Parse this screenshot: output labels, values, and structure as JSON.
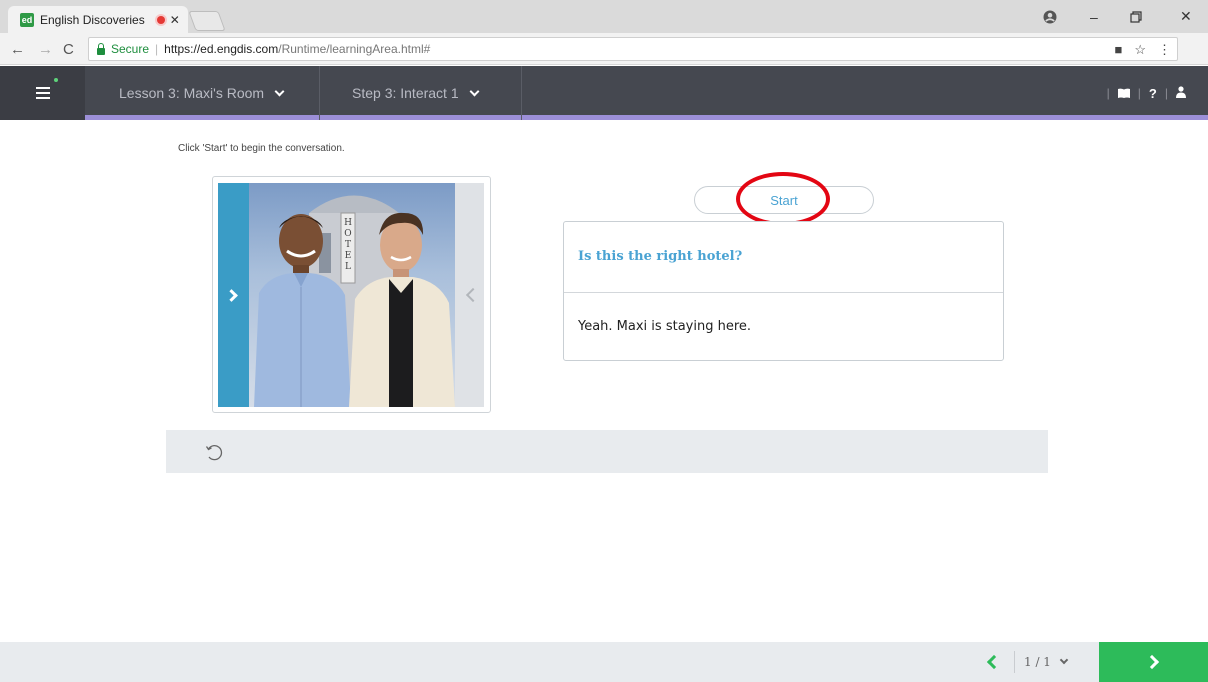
{
  "browser": {
    "tab_title": "English Discoveries",
    "tab_favicon_text": "ed",
    "secure_label": "Secure",
    "url_host": "https://ed.engdis.com",
    "url_path": "/Runtime/learningArea.html#"
  },
  "header": {
    "lesson_label": "Lesson 3: Maxi's Room",
    "step_label": "Step 3: Interact 1"
  },
  "content": {
    "instruction": "Click 'Start' to begin the conversation.",
    "start_label": "Start",
    "question": "Is this the right hotel?",
    "answer": "Yeah. Maxi is staying here.",
    "photo_sign_text": "HOTEL"
  },
  "footer": {
    "page_indicator": "1 / 1"
  },
  "colors": {
    "accent_blue": "#4aa3d3",
    "header_bg": "#454850",
    "header_underline": "#9c8fd8",
    "next_green": "#2dbb5a",
    "highlight_red": "#e30613"
  }
}
